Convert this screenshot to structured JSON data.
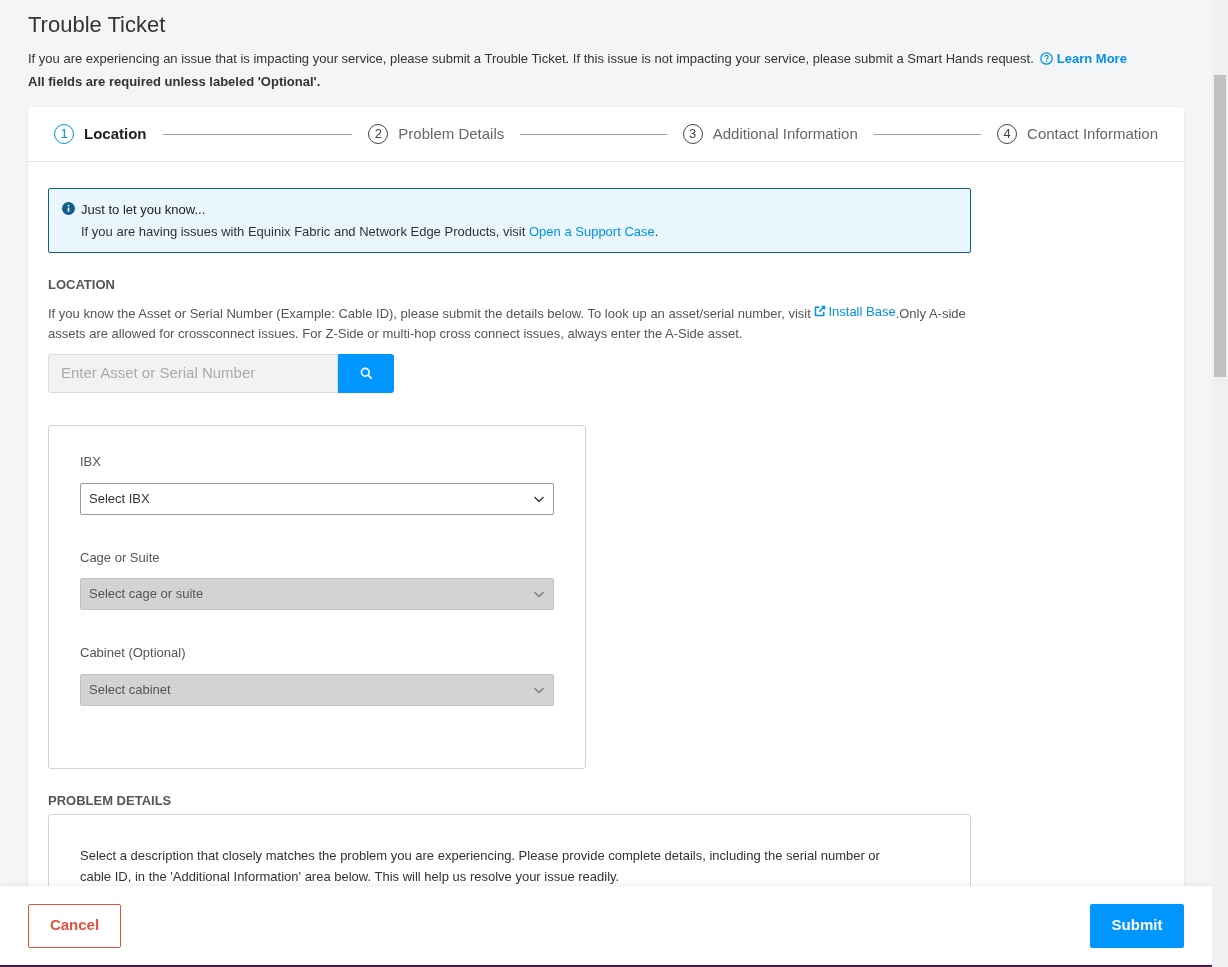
{
  "page": {
    "title": "Trouble Ticket",
    "intro": "If you are experiencing an issue that is impacting your service, please submit a Trouble Ticket. If this issue is not impacting your service, please submit a Smart Hands request.",
    "learn_more": "Learn More",
    "required_note": "All fields are required unless labeled 'Optional'."
  },
  "steps": [
    {
      "number": "1",
      "label": "Location",
      "selected": true
    },
    {
      "number": "2",
      "label": "Problem Details",
      "selected": false
    },
    {
      "number": "3",
      "label": "Additional Information",
      "selected": false
    },
    {
      "number": "4",
      "label": "Contact Information",
      "selected": false
    }
  ],
  "notice": {
    "title": "Just to let you know...",
    "text": "If you are having issues with Equinix Fabric and Network Edge Products, visit",
    "link": "Open a Support Case",
    "after": "."
  },
  "location": {
    "heading": "LOCATION",
    "text_before": "If you know the Asset or Serial Number (Example: Cable ID), please submit the details below. To look up an asset/serial number, visit",
    "link": "Install Base",
    "text_after": ".Only A-side assets are allowed for crossconnect issues. For Z-Side or multi-hop cross connect issues, always enter the A-Side asset.",
    "search_placeholder": "Enter Asset or Serial Number",
    "fields": [
      {
        "label": "IBX",
        "value": "Select IBX",
        "disabled": false
      },
      {
        "label": "Cage or Suite",
        "value": "Select cage or suite",
        "disabled": true
      },
      {
        "label": "Cabinet (Optional)",
        "value": "Select cabinet",
        "disabled": true
      }
    ]
  },
  "problem_details": {
    "heading": "PROBLEM DETAILS",
    "text": "Select a description that closely matches the problem you are experiencing. Please provide complete details, including the serial number or cable ID, in the 'Additional Information' area below. This will help us resolve your issue readily."
  },
  "footer": {
    "cancel": "Cancel",
    "submit": "Submit"
  }
}
